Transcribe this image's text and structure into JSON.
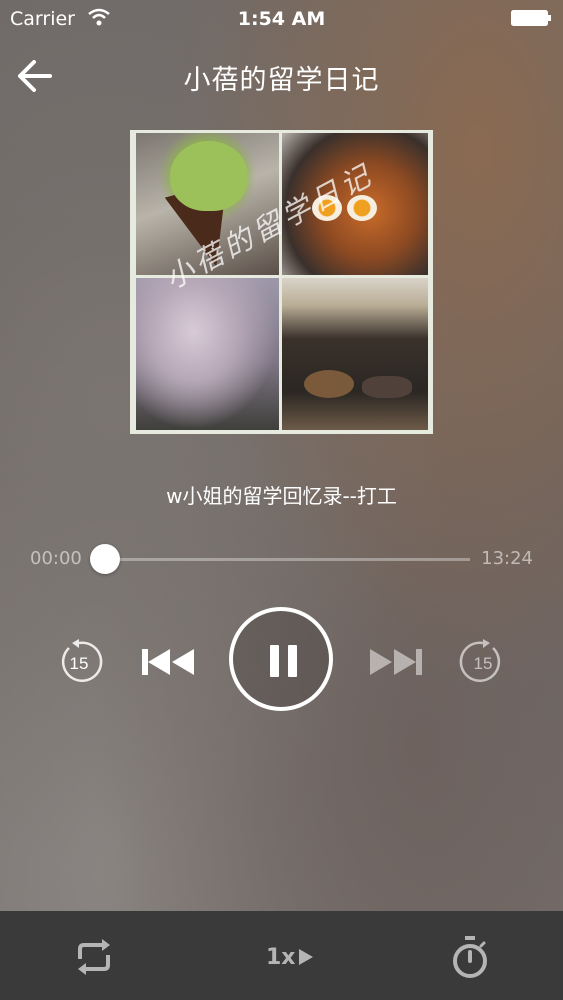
{
  "status_bar": {
    "carrier": "Carrier",
    "time": "1:54 AM"
  },
  "nav": {
    "title": "小蓓的留学日记",
    "back_icon": "arrow-left-icon"
  },
  "cover": {
    "watermark": "小蓓的留学日记"
  },
  "episode": {
    "title": "w小姐的留学回忆录--打工"
  },
  "progress": {
    "current": "00:00",
    "duration": "13:24",
    "fraction": 0.03
  },
  "controls": {
    "rewind_seconds": "15",
    "forward_seconds": "15",
    "state": "playing"
  },
  "bottom_bar": {
    "speed_label": "1x"
  }
}
